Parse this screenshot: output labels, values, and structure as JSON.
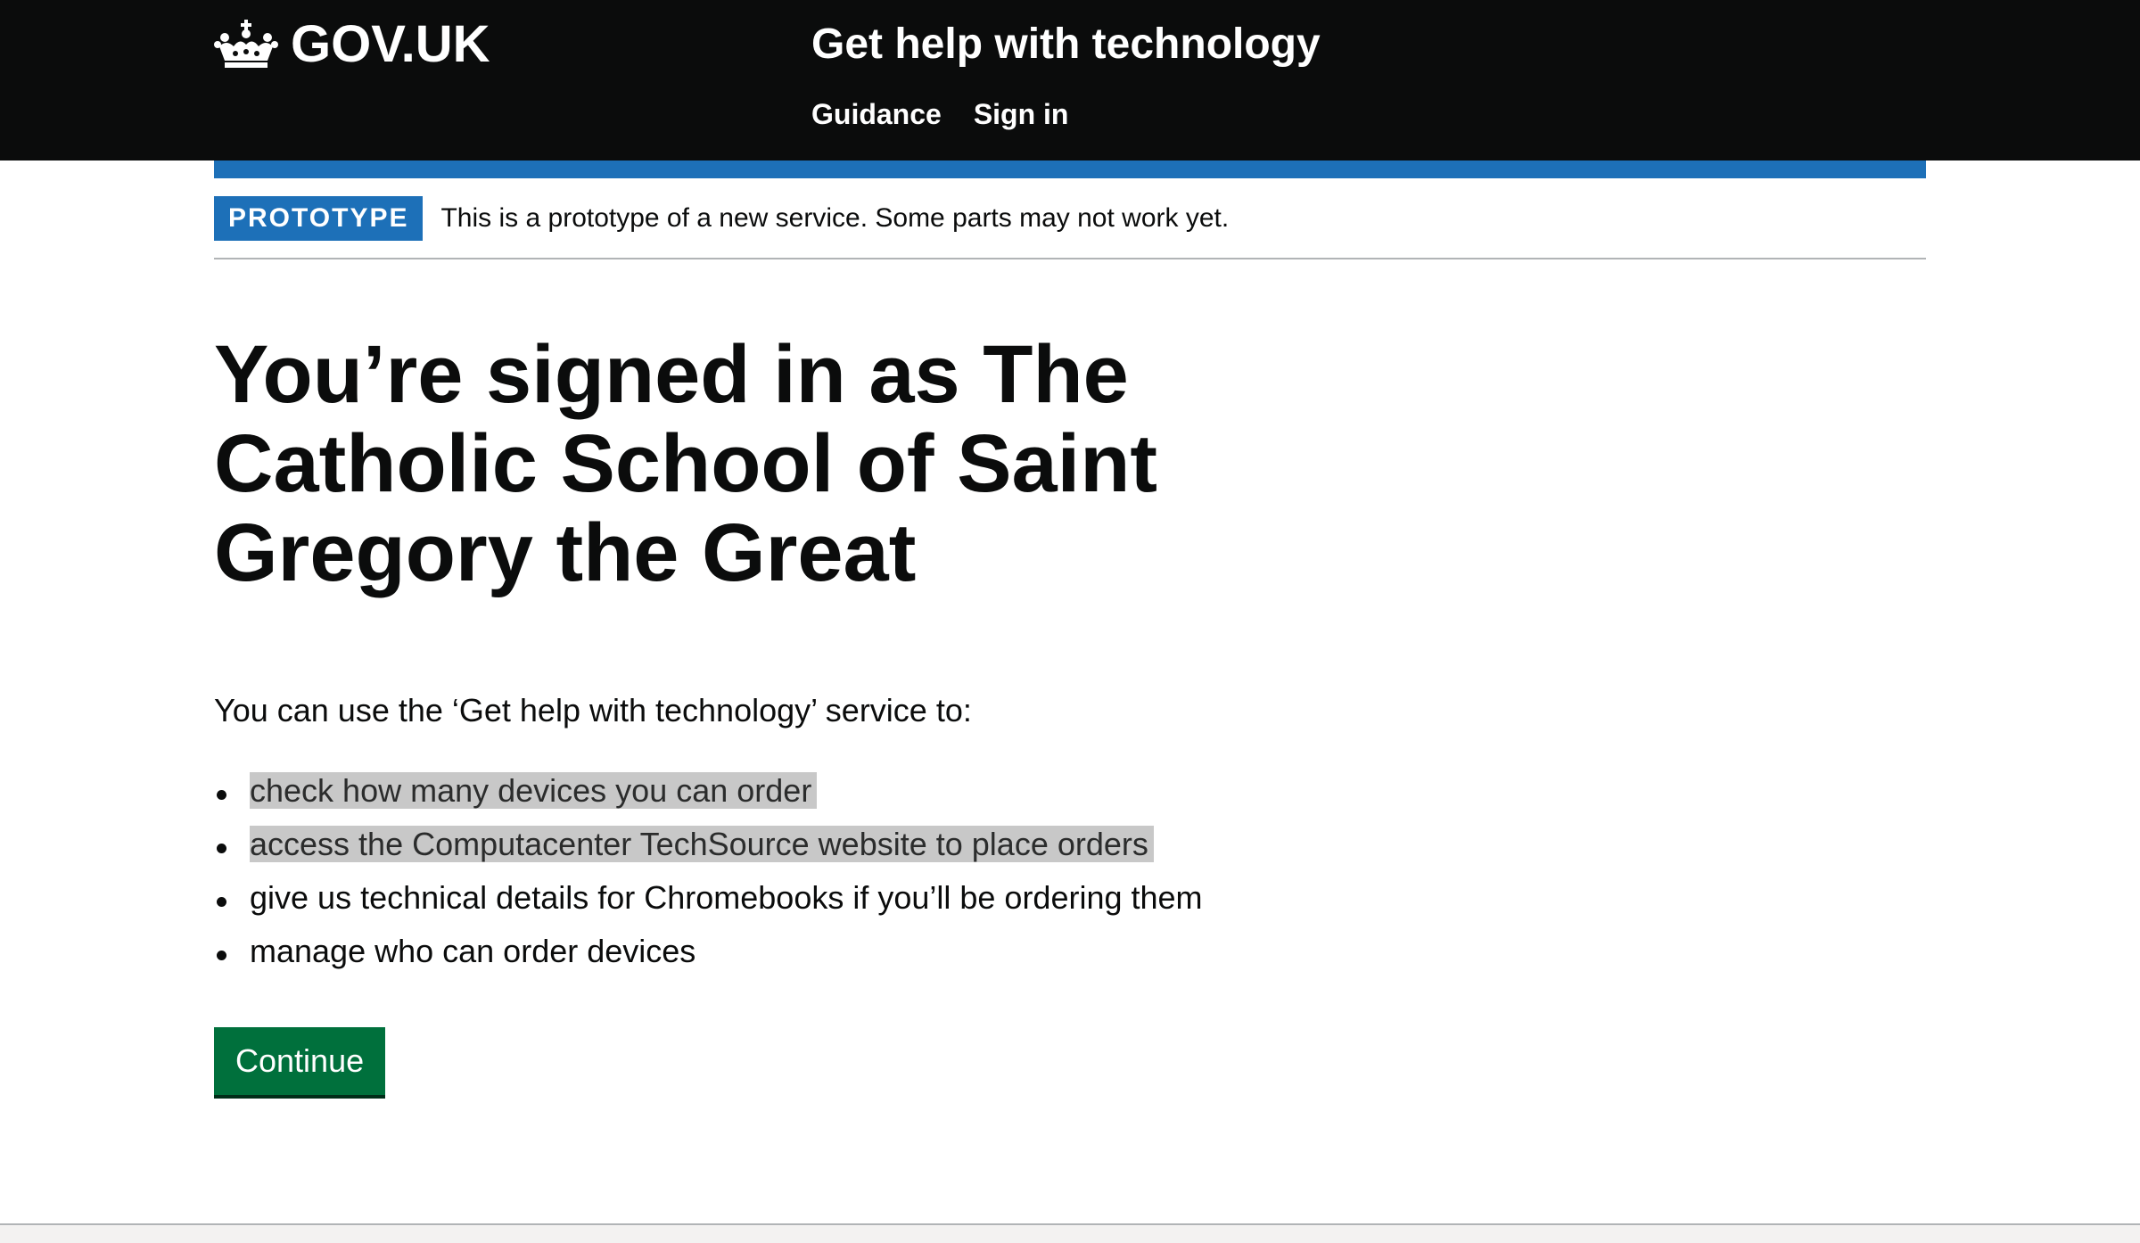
{
  "header": {
    "logo_text": "GOV.UK",
    "logo_icon": "crown-icon",
    "service_name": "Get help with technology",
    "nav": [
      {
        "label": "Guidance"
      },
      {
        "label": "Sign in"
      }
    ],
    "background_color": "#0b0c0c"
  },
  "phase_banner": {
    "tag": "PROTOTYPE",
    "text": "This is a prototype of a new service. Some parts may not work yet.",
    "tag_color": "#1d70b8"
  },
  "main": {
    "title": "You’re signed in as The Catholic School of Saint Gregory the Great",
    "intro": "You can use the ‘Get help with technology’ service to:",
    "list": [
      {
        "text": "check how many devices you can order",
        "highlighted": true
      },
      {
        "text": "access the Computacenter TechSource website to place orders",
        "highlighted": true
      },
      {
        "text": "give us technical details for Chromebooks if you’ll be ordering them",
        "highlighted": false
      },
      {
        "text": "manage who can order devices",
        "highlighted": false
      }
    ],
    "continue_label": "Continue",
    "button_color": "#00703c"
  }
}
